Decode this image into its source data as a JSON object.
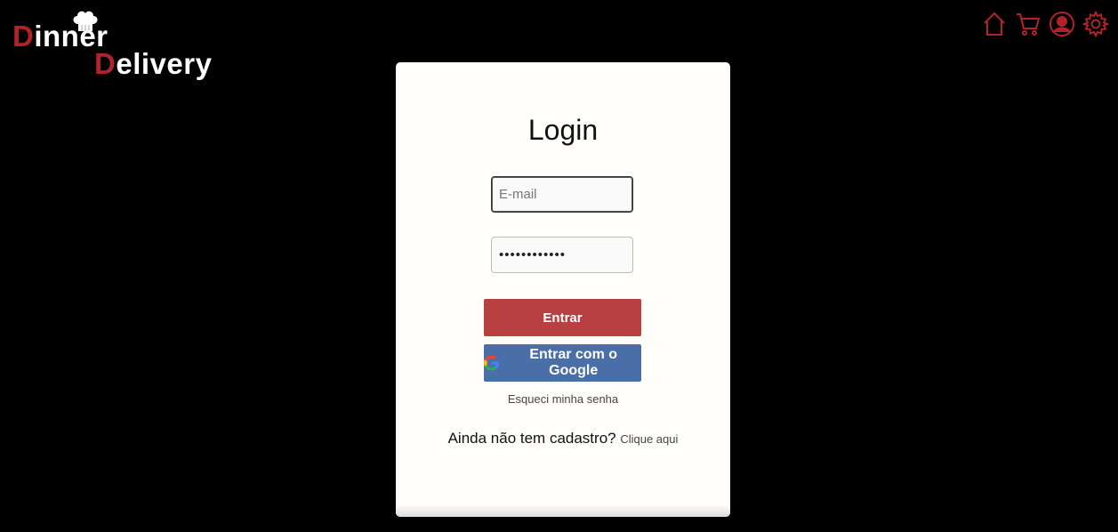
{
  "brand": {
    "line1_initial": "D",
    "line1_rest": "inner",
    "line2_initial": "D",
    "line2_rest": "elivery",
    "accent_color": "#b0232a"
  },
  "nav": {
    "icons": [
      "home-icon",
      "cart-icon",
      "profile-icon",
      "settings-icon"
    ],
    "icon_color": "#b0232a"
  },
  "login": {
    "title": "Login",
    "email_placeholder": "E-mail",
    "email_value": "",
    "password_value": "••••••••••••",
    "submit_label": "Entrar",
    "submit_color": "#b84040",
    "google_label": "Entrar com o Google",
    "google_color": "#4a6fa8",
    "forgot_label": "Esqueci minha senha",
    "signup_prompt": "Ainda não tem cadastro?",
    "signup_link": "Clique aqui"
  }
}
